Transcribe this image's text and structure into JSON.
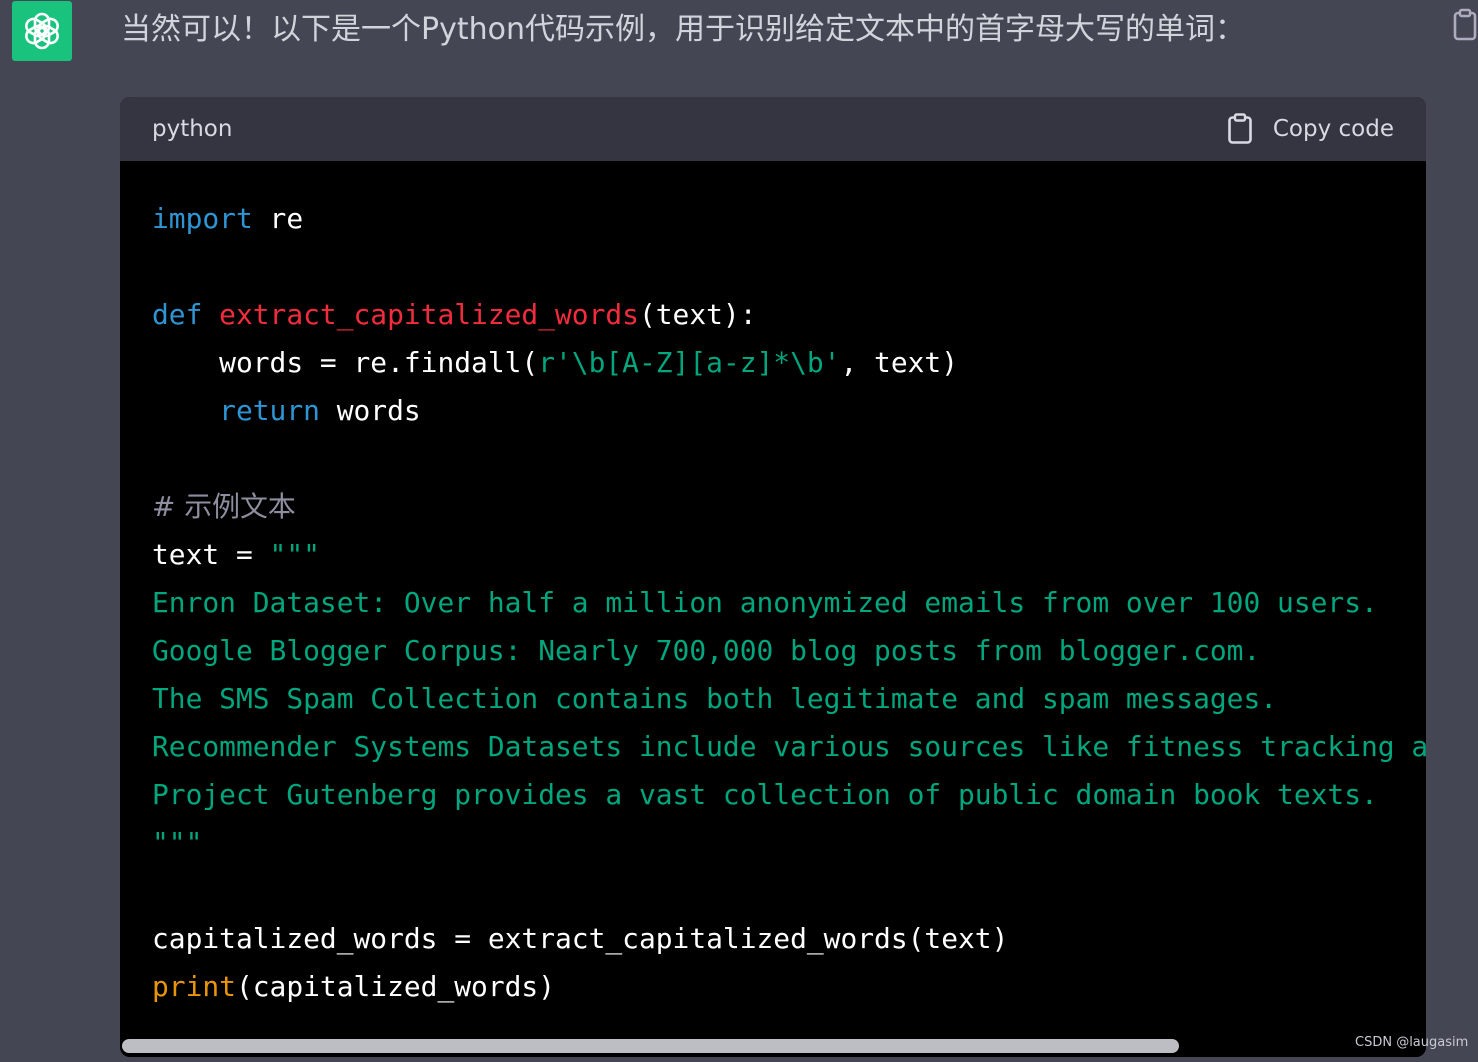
{
  "message": {
    "text": "当然可以！以下是一个Python代码示例，用于识别给定文本中的首字母大写的单词："
  },
  "code_block": {
    "language": "python",
    "copy_label": "Copy code",
    "lines": [
      [
        {
          "t": "import",
          "c": "kw"
        },
        {
          "t": " re",
          "c": "plain"
        }
      ],
      [],
      [
        {
          "t": "def",
          "c": "kw"
        },
        {
          "t": " ",
          "c": "plain"
        },
        {
          "t": "extract_capitalized_words",
          "c": "fn"
        },
        {
          "t": "(text):",
          "c": "plain"
        }
      ],
      [
        {
          "t": "    words = re.findall(",
          "c": "plain"
        },
        {
          "t": "r'\\b[A-Z][a-z]*\\b'",
          "c": "str"
        },
        {
          "t": ", text)",
          "c": "plain"
        }
      ],
      [
        {
          "t": "    ",
          "c": "plain"
        },
        {
          "t": "return",
          "c": "kw"
        },
        {
          "t": " words",
          "c": "plain"
        }
      ],
      [],
      [
        {
          "t": "# 示例文本",
          "c": "cmt"
        }
      ],
      [
        {
          "t": "text = ",
          "c": "plain"
        },
        {
          "t": "\"\"\"",
          "c": "str"
        }
      ],
      [
        {
          "t": "Enron Dataset: Over half a million anonymized emails from over 100 users.",
          "c": "str"
        }
      ],
      [
        {
          "t": "Google Blogger Corpus: Nearly 700,000 blog posts from blogger.com.",
          "c": "str"
        }
      ],
      [
        {
          "t": "The SMS Spam Collection contains both legitimate and spam messages.",
          "c": "str"
        }
      ],
      [
        {
          "t": "Recommender Systems Datasets include various sources like fitness tracking a",
          "c": "str"
        }
      ],
      [
        {
          "t": "Project Gutenberg provides a vast collection of public domain book texts.",
          "c": "str"
        }
      ],
      [
        {
          "t": "\"\"\"",
          "c": "str"
        }
      ],
      [],
      [
        {
          "t": "capitalized_words = extract_capitalized_words(text)",
          "c": "plain"
        }
      ],
      [
        {
          "t": "print",
          "c": "bi"
        },
        {
          "t": "(capitalized_words)",
          "c": "plain"
        }
      ]
    ]
  },
  "watermark": "CSDN @laugasim",
  "colors": {
    "page_bg": "#444654",
    "avatar_bg": "#19c37d",
    "code_bg": "#000000",
    "code_header_bg": "#343541",
    "keyword": "#2e95d3",
    "function": "#f22c3d",
    "string": "#00a67d",
    "comment": "#8e8ea0",
    "builtin": "#e9950c"
  },
  "icons": {
    "avatar": "openai-logo-icon",
    "copy_message": "clipboard-icon",
    "copy_code": "clipboard-icon"
  }
}
